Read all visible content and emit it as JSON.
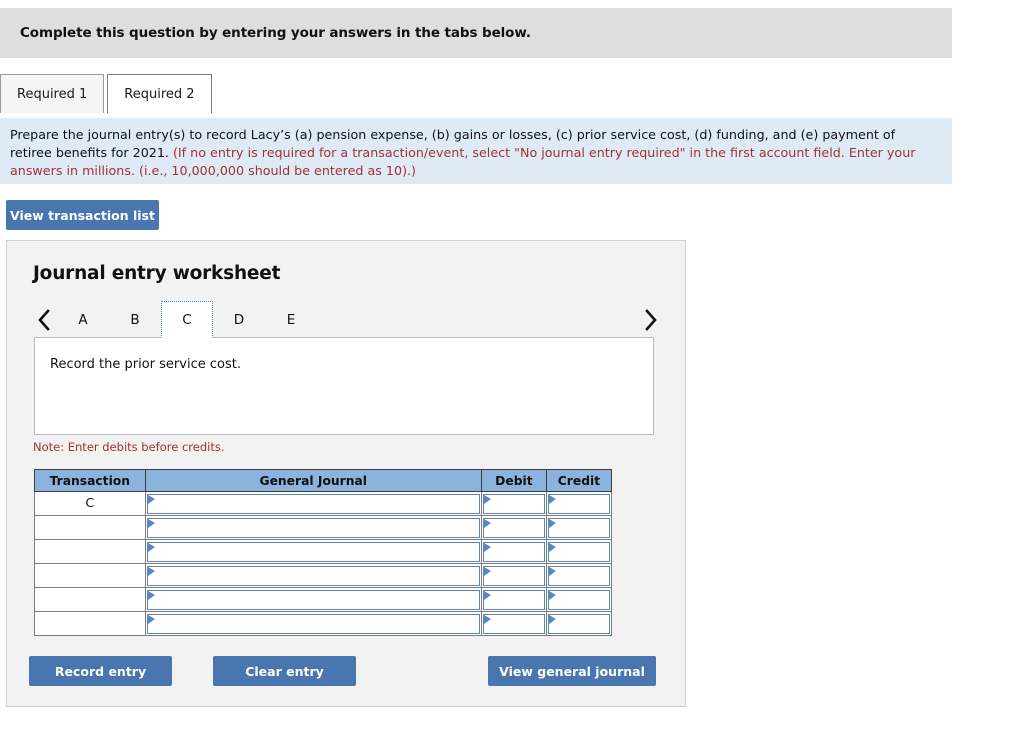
{
  "banner": {
    "text": "Complete this question by entering your answers in the tabs below."
  },
  "tabs": [
    {
      "label": "Required 1",
      "active": false
    },
    {
      "label": "Required 2",
      "active": true
    }
  ],
  "instructions": {
    "plain": "Prepare the journal entry(s) to record Lacy’s (a) pension expense, (b) gains or losses, (c) prior service cost, (d) funding, and (e) payment of retiree benefits for 2021. ",
    "note": "(If no entry is required for a transaction/event, select \"No journal entry required\" in the first account field. Enter your answers in millions. (i.e., 10,000,000 should be entered as 10).)"
  },
  "toolbar": {
    "view_transaction_list": "View transaction list"
  },
  "worksheet": {
    "title": "Journal entry worksheet",
    "prev_arrow_icon": "chevron-left-icon",
    "next_arrow_icon": "chevron-right-icon",
    "letter_tabs": [
      {
        "label": "A",
        "selected": false
      },
      {
        "label": "B",
        "selected": false
      },
      {
        "label": "C",
        "selected": true
      },
      {
        "label": "D",
        "selected": false
      },
      {
        "label": "E",
        "selected": false
      }
    ],
    "description": "Record the prior service cost.",
    "note": "Note: Enter debits before credits.",
    "table": {
      "headers": [
        "Transaction",
        "General Journal",
        "Debit",
        "Credit"
      ],
      "rows": [
        {
          "transaction": "C",
          "general_journal": "",
          "debit": "",
          "credit": ""
        },
        {
          "transaction": "",
          "general_journal": "",
          "debit": "",
          "credit": ""
        },
        {
          "transaction": "",
          "general_journal": "",
          "debit": "",
          "credit": ""
        },
        {
          "transaction": "",
          "general_journal": "",
          "debit": "",
          "credit": ""
        },
        {
          "transaction": "",
          "general_journal": "",
          "debit": "",
          "credit": ""
        },
        {
          "transaction": "",
          "general_journal": "",
          "debit": "",
          "credit": ""
        }
      ]
    },
    "buttons": {
      "record_entry": "Record entry",
      "clear_entry": "Clear entry",
      "view_general_journal": "View general journal"
    }
  },
  "colors": {
    "banner_gray": "#dedede",
    "instruction_blue": "#dfeaf7",
    "note_red": "#a33232",
    "button_blue": "#4a76b0",
    "table_header_blue": "#8cb2de",
    "field_border_blue": "#5a86c0",
    "panel_gray": "#f2f2f2"
  }
}
